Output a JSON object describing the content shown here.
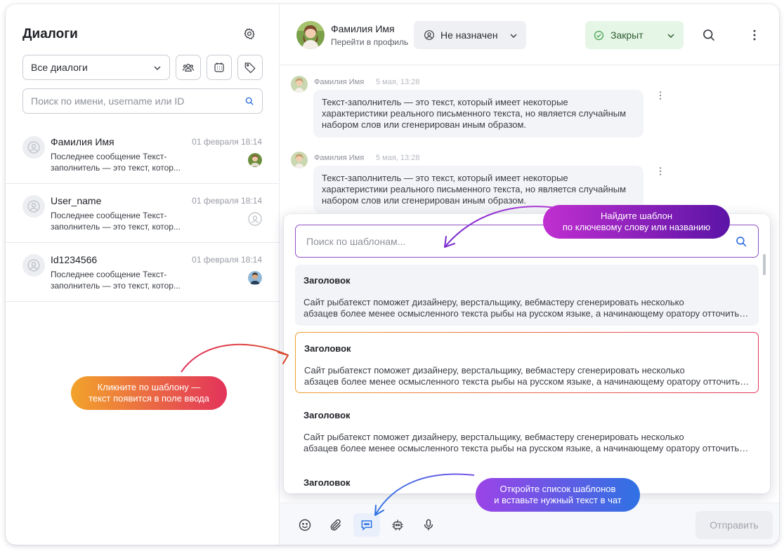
{
  "sidebar": {
    "title": "Диалоги",
    "filter_value": "Все диалоги",
    "search_placeholder": "Поиск по имени, username или ID",
    "dialogs": [
      {
        "name": "Фамилия Имя",
        "date": "01 февраля 18:14",
        "message": "Последнее сообщение Текст-заполнитель — это текст, котор..."
      },
      {
        "name": "User_name",
        "date": "01 февраля 18:14",
        "message": "Последнее сообщение Текст-заполнитель — это текст, котор..."
      },
      {
        "name": "Id1234566",
        "date": "01 февраля 18:14",
        "message": "Последнее сообщение Текст-заполнитель — это текст, котор..."
      }
    ]
  },
  "header": {
    "contact_name": "Фамилия Имя",
    "profile_link": "Перейти в профиль",
    "assignee": "Не назначен",
    "status": "Закрыт"
  },
  "messages": [
    {
      "author": "Фамилия Имя",
      "time": "5 мая, 13:28",
      "text": "Текст-заполнитель — это текст, который имеет некоторые характеристики реального письменного текста, но является случайным набором слов или сгенерирован иным образом."
    },
    {
      "author": "Фамилия Имя",
      "time": "5 мая, 13:28",
      "text": "Текст-заполнитель — это текст, который имеет некоторые характеристики реального письменного текста, но является случайным набором слов или сгенерирован иным образом."
    }
  ],
  "templates": {
    "search_placeholder": "Поиск по шаблонам...",
    "items": [
      {
        "title": "Заголовок",
        "line1": "Сайт рыбатекст поможет дизайнеру, верстальщику, вебмастеру сгенерировать несколько",
        "line2": "абзацев более менее осмысленного текста рыбы на русском языке, а начинающему оратору отточить навык публичных выступлений в домашних условиях."
      },
      {
        "title": "Заголовок",
        "line1": "Сайт рыбатекст поможет дизайнеру, верстальщику, вебмастеру сгенерировать несколько",
        "line2": "абзацев более менее осмысленного текста рыбы на русском языке, а начинающему оратору отточить навык публичных выступлений в домашних условиях."
      },
      {
        "title": "Заголовок",
        "line1": "Сайт рыбатекст поможет дизайнеру, верстальщику, вебмастеру сгенерировать несколько",
        "line2": "абзацев более менее осмысленного текста рыбы на русском языке, а начинающему оратору отточить навык публичных выступлений в домашних условиях."
      },
      {
        "title": "Заголовок"
      }
    ]
  },
  "composer": {
    "send_label": "Отправить"
  },
  "hints": {
    "search": {
      "line1": "Найдите шаблон",
      "line2": "по ключевому слову или названию"
    },
    "click": {
      "line1": "Кликните по шаблону —",
      "line2": "текст появится в поле ввода"
    },
    "open": {
      "line1": "Откройте список шаблонов",
      "line2": "и вставьте нужный текст в чат"
    }
  },
  "colors": {
    "accent_purple": "#8f4fc6",
    "status_green_bg": "#e5f5e6",
    "hint_orange": "#f2a32b",
    "hint_red": "#e3335b",
    "hint_blue": "#2f72e3"
  },
  "icons": {
    "settings": "gear-icon",
    "groups": "users-icon",
    "calendar": "calendar-icon",
    "tags": "tag-icon",
    "search": "search-icon",
    "assignee": "user-circle-icon",
    "status": "check-circle-icon",
    "more": "more-vertical-icon",
    "emoji": "smile-icon",
    "attach": "paperclip-icon",
    "templates": "chat-template-icon",
    "bot": "bot-icon",
    "voice": "microphone-icon"
  }
}
